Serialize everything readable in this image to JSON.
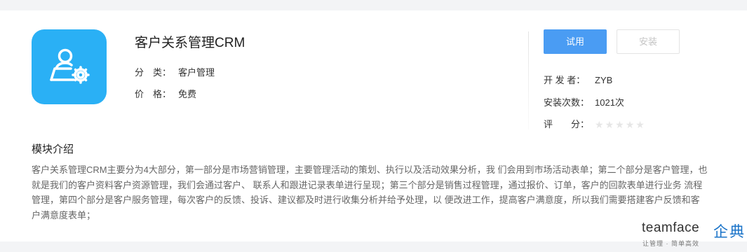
{
  "app": {
    "name": "客户关系管理CRM",
    "category_label": "分　类：",
    "category_value": "客户管理",
    "price_label": "价　格：",
    "price_value": "免费"
  },
  "actions": {
    "try_label": "试用",
    "install_label": "安装"
  },
  "side": {
    "developer_label": "开 发 者：",
    "developer_value": "ZYB",
    "installs_label": "安装次数：",
    "installs_value": "1021次",
    "rating_label": "评　　分：",
    "rating_value": 0,
    "rating_max": 5
  },
  "module": {
    "title": "模块介绍",
    "description": "客户关系管理CRM主要分为4大部分，第一部分是市场营销管理，主要管理活动的策划、执行以及活动效果分析，我 们会用到市场活动表单；第二个部分是客户管理，也就是我们的客户资料客户资源管理，我们会通过客户、 联系人和跟进记录表单进行呈现；第三个部分是销售过程管理，通过报价、订单，客户的回款表单进行业务 流程管理，第四个部分是客户服务管理，每次客户的反馈、投诉、建议都及时进行收集分析并给予处理，以 便改进工作，提高客户满意度，所以我们需要搭建客户反馈和客户满意度表单；"
  },
  "icons": {
    "app_icon": "user-gear-icon",
    "star": "star-icon"
  },
  "colors": {
    "app_icon_bg": "#2ab0f5",
    "primary_button": "#4a9cf3",
    "brand_blue": "#1a73c8"
  },
  "watermark": {
    "en": "teamface",
    "cn": "企典",
    "sub": "让管理 · 简单高效"
  }
}
